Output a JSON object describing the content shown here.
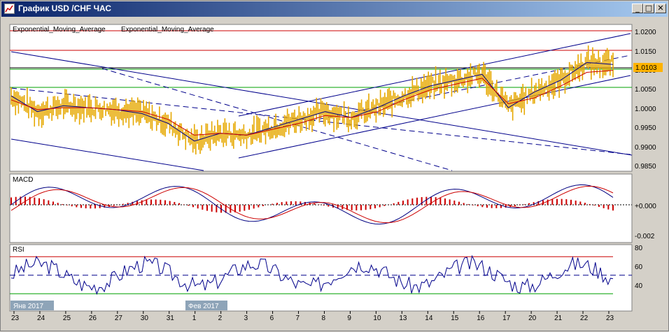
{
  "window": {
    "title": "График USD /CHF ЧАС",
    "min_glyph": "_",
    "max_glyph": "□",
    "close_glyph": "✕"
  },
  "legend": {
    "ema1": "Exponential_Moving_Average",
    "ema2": "Exponential_Moving_Average",
    "ema1_color": "#00008b",
    "ema2_color": "#cc0000"
  },
  "price_panel": {
    "axis_labels": [
      "1.0200",
      "1.0150",
      "1.0100",
      "1.0050",
      "1.0000",
      "0.9950",
      "0.9900",
      "0.9850"
    ],
    "current_price": "1.0103",
    "current_price_color": "#ffb300"
  },
  "macd_panel": {
    "title": "MACD",
    "axis_labels": [
      "+0.000",
      "-0.002"
    ]
  },
  "rsi_panel": {
    "title": "RSI",
    "axis_labels": [
      "80",
      "60",
      "40"
    ],
    "upper_level": 70,
    "lower_level": 30
  },
  "dates": [
    "23",
    "24",
    "25",
    "26",
    "27",
    "30",
    "31",
    "1",
    "2",
    "3",
    "6",
    "7",
    "8",
    "9",
    "10",
    "13",
    "14",
    "15",
    "16",
    "17",
    "20",
    "21",
    "22",
    "23"
  ],
  "month_markers": [
    "Янв 2017",
    "Фев 2017"
  ],
  "colors": {
    "bars": "#e6a800",
    "channel": "#00008b",
    "resistance": "#cc0000",
    "support": "#00a000",
    "rsi_overbought": "#cc33cc",
    "rsi_oversold": "#33cc33"
  },
  "chart_data": {
    "type": "line",
    "x": [
      "23",
      "24",
      "25",
      "26",
      "27",
      "30",
      "31",
      "1",
      "2",
      "3",
      "6",
      "7",
      "8",
      "9",
      "10",
      "13",
      "14",
      "15",
      "16",
      "17",
      "20",
      "21",
      "22",
      "23"
    ],
    "series": [
      {
        "name": "Exponential_Moving_Average",
        "values": [
          1.003,
          0.999,
          1.0005,
          1.0,
          0.9995,
          0.9985,
          0.996,
          0.9915,
          0.9935,
          0.993,
          0.995,
          0.997,
          0.999,
          0.9975,
          1.0,
          1.003,
          1.0055,
          1.007,
          1.0085,
          1.0,
          1.004,
          1.007,
          1.0115,
          1.011
        ]
      },
      {
        "name": "Exponential_Moving_Average",
        "values": [
          1.002,
          0.9995,
          1.0,
          1.0,
          0.9995,
          0.999,
          0.997,
          0.993,
          0.9935,
          0.993,
          0.9945,
          0.996,
          0.998,
          0.9975,
          0.999,
          1.002,
          1.0045,
          1.006,
          1.0075,
          1.001,
          1.0025,
          1.0055,
          1.009,
          1.0095
        ]
      }
    ],
    "ylim": [
      0.984,
      1.021
    ]
  }
}
